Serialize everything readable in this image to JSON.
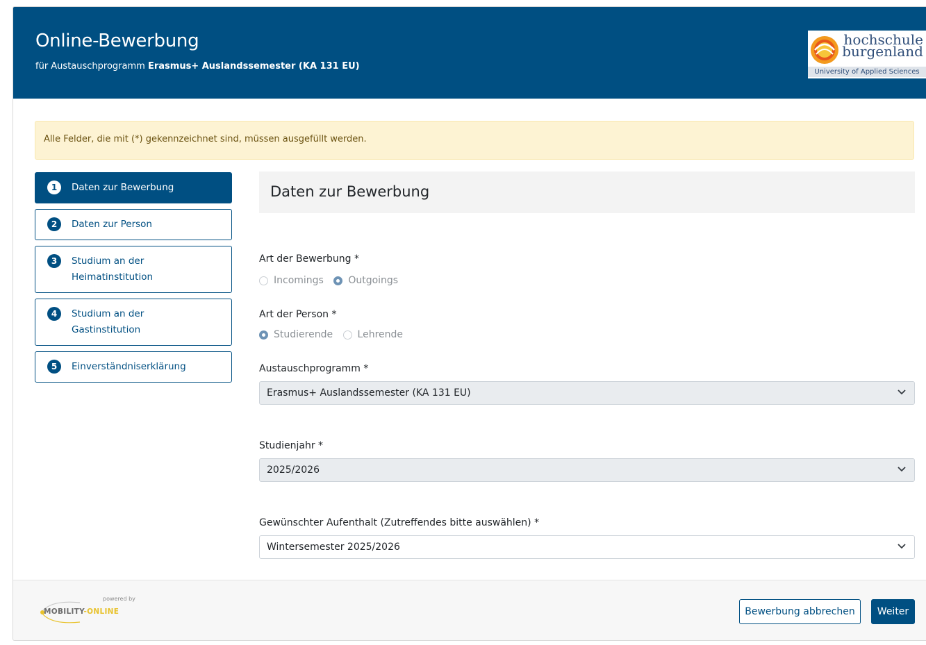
{
  "header": {
    "title": "Online-Bewerbung",
    "subtitle_prefix": "für Austauschprogramm",
    "subtitle_program": "Erasmus+ Auslandssemester (KA 131 EU)",
    "logo": {
      "line1": "hochschule",
      "line2": "burgenland",
      "line3": "University of Applied Sciences"
    }
  },
  "alert": {
    "text": "Alle Felder, die mit (*) gekennzeichnet sind, müssen ausgefüllt werden."
  },
  "steps": [
    {
      "number": "1",
      "label": "Daten zur Bewerbung",
      "active": true
    },
    {
      "number": "2",
      "label": "Daten zur Person",
      "active": false
    },
    {
      "number": "3",
      "label": "Studium an der Heimatinstitution",
      "active": false
    },
    {
      "number": "4",
      "label": "Studium an der Gastinstitution",
      "active": false
    },
    {
      "number": "5",
      "label": "Einverständniserklärung",
      "active": false
    }
  ],
  "form": {
    "section_title": "Daten zur Bewerbung",
    "application_type": {
      "label": "Art der Bewerbung *",
      "options": [
        "Incomings",
        "Outgoings"
      ],
      "selected": "Outgoings"
    },
    "person_type": {
      "label": "Art der Person *",
      "options": [
        "Studierende",
        "Lehrende"
      ],
      "selected": "Studierende"
    },
    "exchange_program": {
      "label": "Austauschprogramm *",
      "value": "Erasmus+ Auslandssemester (KA 131 EU)"
    },
    "academic_year": {
      "label": "Studienjahr *",
      "value": "2025/2026"
    },
    "desired_stay": {
      "label": "Gewünschter Aufenthalt (Zutreffendes bitte auswählen) *",
      "value": "Wintersemester 2025/2026"
    }
  },
  "footer": {
    "powered_by": "powered by",
    "brand_part1": "MOBILITY",
    "brand_part2": "-ONLINE",
    "cancel_label": "Bewerbung abbrechen",
    "next_label": "Weiter"
  },
  "colors": {
    "primary": "#004f82",
    "alert_bg": "#fdf3d3",
    "alert_text": "#6b5312",
    "brand_yellow": "#e8c22b"
  }
}
